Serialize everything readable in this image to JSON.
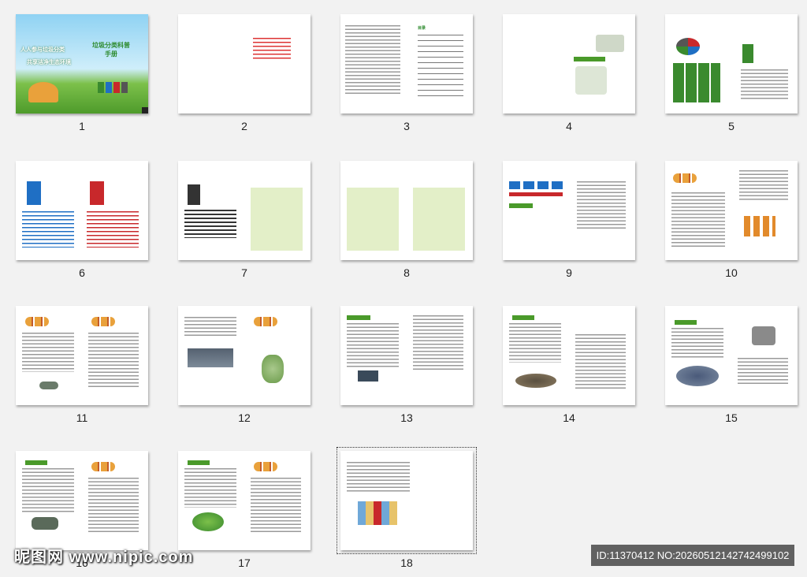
{
  "pages": [
    {
      "number": "1",
      "cover_title": "垃圾分类科普手册",
      "cover_subtitle_1": "人人参与垃圾分类",
      "cover_subtitle_2": "共享洁净生态环境"
    },
    {
      "number": "2"
    },
    {
      "number": "3",
      "toc_label": "目录"
    },
    {
      "number": "4"
    },
    {
      "number": "5"
    },
    {
      "number": "6"
    },
    {
      "number": "7"
    },
    {
      "number": "8"
    },
    {
      "number": "9"
    },
    {
      "number": "10"
    },
    {
      "number": "11"
    },
    {
      "number": "12"
    },
    {
      "number": "13"
    },
    {
      "number": "14"
    },
    {
      "number": "15"
    },
    {
      "number": "16"
    },
    {
      "number": "17"
    },
    {
      "number": "18"
    }
  ],
  "watermark": {
    "site": "昵图网 www.nipic.com",
    "id_text": "ID:11370412 NO:20260512142742499102"
  },
  "colors": {
    "green": "#4a9a2a",
    "blue": "#1f6fc4",
    "red": "#c8282b",
    "sky": "#6fc3ec"
  }
}
